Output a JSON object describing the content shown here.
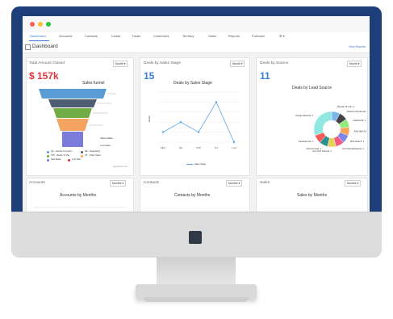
{
  "colors": {
    "bezel": "#1d3e79",
    "accent": "#3a7bd5",
    "amount_red": "#e5343c",
    "stage_blue": "#3a7bd5",
    "line_series": "#5aa6e6",
    "window_dots": [
      "#ff5f57",
      "#febc2e",
      "#28c840"
    ]
  },
  "nav": {
    "tabs": [
      {
        "label": "Dashboard",
        "active": true
      },
      {
        "label": "Accounts"
      },
      {
        "label": "Contacts"
      },
      {
        "label": "Leads"
      },
      {
        "label": "Deals"
      },
      {
        "label": "Customers"
      },
      {
        "label": "Territory"
      },
      {
        "label": "Sales"
      },
      {
        "label": "Reports"
      },
      {
        "label": "Forecast"
      },
      {
        "label": "⚙ ▾"
      }
    ]
  },
  "page": {
    "title": "Dashboard",
    "link": "View Reports"
  },
  "cards": {
    "total": {
      "title": "Total Amount Closed",
      "dropdown": "Month ▾",
      "value": "$ 157k",
      "chart_title": "Sales funnel",
      "footnote": "Highcharts.com"
    },
    "stage": {
      "title": "Deals by Sales Stage",
      "dropdown": "Month ▾",
      "value": "15",
      "chart_title": "Deals by Sales Stage",
      "ylabel": "Deals",
      "legend": "Sales Stage"
    },
    "source": {
      "title": "Deals by Source",
      "dropdown": "Month ▾",
      "value": "11",
      "chart_title": "Deals by Lead Source"
    },
    "accounts": {
      "title": "Accounts",
      "dropdown": "Months ▾",
      "chart_title": "Accounts by Months"
    },
    "contacts": {
      "title": "Contacts",
      "dropdown": "Months ▾",
      "chart_title": "Contacts by Months"
    },
    "sales": {
      "title": "Sales",
      "dropdown": "Months ▾",
      "chart_title": "Sales by Months"
    }
  },
  "funnel": {
    "colors": [
      "#5b9bd5",
      "#4f5d73",
      "#70ad47",
      "#f4a460",
      "#7b7bdc"
    ],
    "labels": [
      "Sales Made",
      "Lost Sale, ..."
    ]
  },
  "funnel_legend": [
    {
      "label": "QC - Decide & Confirm",
      "color": "#5b9bd5"
    },
    {
      "label": "NE - Negotiating",
      "color": "#4f5d73"
    },
    {
      "label": "STP - Ready To Pay",
      "color": "#70ad47"
    },
    {
      "label": "OT - Order Taken",
      "color": "#f4a460"
    },
    {
      "label": "Sale Made",
      "color": "#7b7bdc"
    },
    {
      "label": "Lost Sale",
      "color": "#e5343c"
    }
  ],
  "chart_data": [
    {
      "type": "line",
      "title": "Deals by Sales Stage",
      "ylabel": "Deals",
      "categories": [
        "SEU",
        "NG",
        "STP",
        "OT",
        "Lost"
      ],
      "series": [
        {
          "name": "Sales Stage",
          "values": [
            1,
            2,
            1,
            4,
            0
          ]
        }
      ],
      "ylim": [
        0,
        5
      ],
      "grid": true,
      "legend": "bottom"
    },
    {
      "type": "pie",
      "title": "Deals by Lead Source",
      "slices": [
        {
          "label": "Manual US Coin: 1",
          "color": "#7cb5ec",
          "value": 1
        },
        {
          "label": "Missed Call General: 1",
          "color": "#434348",
          "value": 1
        },
        {
          "label": "JustDial Ad: 1",
          "color": "#90ed7d",
          "value": 1
        },
        {
          "label": "Paid Web Ad: 1",
          "color": "#f7a35c",
          "value": 1
        },
        {
          "label": "Web Search: 1",
          "color": "#8085e9",
          "value": 1
        },
        {
          "label": "Live Chat Exhaustive: 1",
          "color": "#f15c80",
          "value": 1
        },
        {
          "label": "Live Chat Inbound: 1",
          "color": "#e4d354",
          "value": 1
        },
        {
          "label": "Inbound Lead: 1",
          "color": "#2b908f",
          "value": 1
        },
        {
          "label": "Facebook Ad: 1",
          "color": "#f45b5b",
          "value": 1
        },
        {
          "label": "Google Adwords: 4",
          "color": "#91e8e1",
          "value": 4
        }
      ]
    }
  ]
}
